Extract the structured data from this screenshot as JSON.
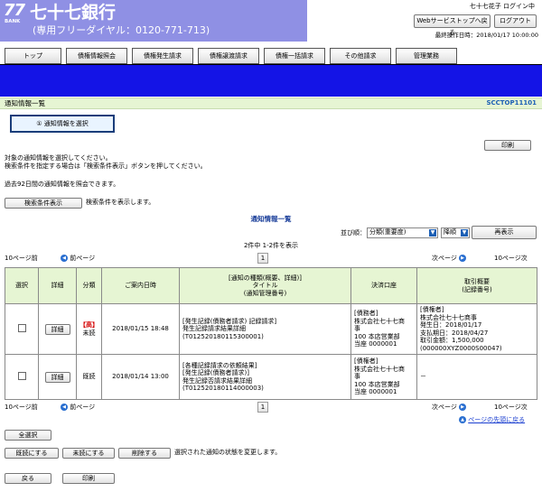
{
  "header": {
    "logo_number": "77",
    "logo_sub": "BANK",
    "bank_name": "七十七銀行",
    "phone": "(専用フリーダイヤル：0120-771-713)",
    "user_status": "七十七花子 ログイン中",
    "web_top_label": "Webサービストップへ戻る",
    "logout_label": "ログアウト",
    "last_operation": "最終操作日時：2018/01/17 10:00:00"
  },
  "tabs": [
    "トップ",
    "債権情報照会",
    "債権発生請求",
    "債権譲渡請求",
    "債権一括請求",
    "その他請求",
    "管理業務"
  ],
  "title_bar": {
    "title": "通知情報一覧",
    "screen_id": "SCCTOP11101"
  },
  "step_box": {
    "label": "① 通知情報を選択"
  },
  "print_label": "印刷",
  "notes": {
    "line1": "対象の通知情報を選択してください。",
    "line2": "検索条件を指定する場合は「検索条件表示」ボタンを押してください。",
    "line3": "過去92日間の通知情報を照会できます。"
  },
  "search": {
    "button_label": "検索条件表示",
    "hint": "検索条件を表示します。"
  },
  "list_heading": "通知情報一覧",
  "sort": {
    "label": "並び順：",
    "key_value": "分類(重要度)",
    "order_value": "降順",
    "redisplay_label": "再表示"
  },
  "count_text": "2件中 1-2件を表示",
  "pager": {
    "prev10": "10ページ前",
    "prev": "前ページ",
    "current": "1",
    "next": "次ページ",
    "next10": "10ページ次"
  },
  "table": {
    "headers": {
      "select": "選択",
      "detail": "詳細",
      "category": "分類",
      "date": "ご案内日時",
      "title_l1": "[通知の種類(概要、詳細)]",
      "title_l2": "タイトル",
      "title_l3": "(通知管理番号)",
      "account": "決済口座",
      "deal_l1": "取引概要",
      "deal_l2": "(記録番号)"
    },
    "rows": [
      {
        "detail_label": "詳細",
        "important": "【高】",
        "category": "未読",
        "date": "2018/01/15 18:48",
        "title_l1": "[発生記録(債務者請求) 記録請求]",
        "title_l2": "発生記録請求結果詳細",
        "title_l3": "(T012520180115300001)",
        "account_l1": "[債務者]",
        "account_l2": "株式会社七十七商",
        "account_l3": "事",
        "account_l4": "100 本店営業部",
        "account_l5": "当座 0000001",
        "deal_l1": "[債権者]",
        "deal_l2": "株式会社七十七商事",
        "deal_l3": "発生日：2018/01/17",
        "deal_l4": "支払期日：2018/04/27",
        "deal_l5": "取引金額：1,500,000",
        "deal_l6": "(000000XYZ0000S00047)"
      },
      {
        "detail_label": "詳細",
        "category": "既読",
        "date": "2018/01/14 13:00",
        "title_l1": "[各種記録請求の依頼結果]",
        "title_l2": "[発生記録(債務者請求)]",
        "title_l3": "発生記録否請求結果詳細",
        "title_l4": "(T012520180114000003)",
        "account_l1": "[債権者]",
        "account_l2": "株式会社七十七商",
        "account_l3": "事",
        "account_l4": "100 本店営業部",
        "account_l5": "当座 0000001",
        "deal_l1": "－"
      }
    ]
  },
  "page_top_link": "ページの先頭に戻る",
  "actions": {
    "select_all": "全選択",
    "mark_read": "既読にする",
    "mark_unread": "未読にする",
    "delete": "削除する",
    "state_hint": "選択された通知の状態を変更します。",
    "back": "戻る",
    "print": "印刷"
  },
  "colors": {
    "header_purple": "#8f90e4",
    "nav_blue": "#1414e6",
    "title_green": "#e6f5d3",
    "link_blue": "#1b3fd0",
    "highlight_red": "#e53030"
  }
}
